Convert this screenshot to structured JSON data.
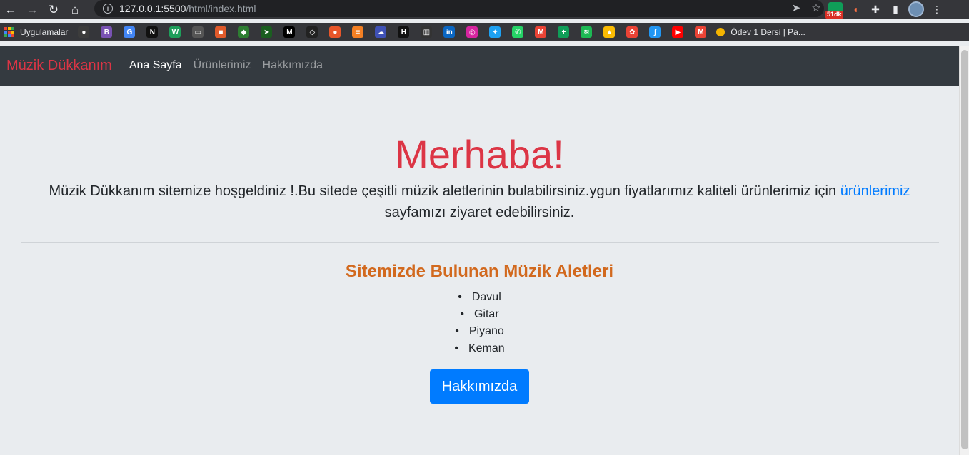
{
  "browser": {
    "url_host": "127.0.0.1:5500",
    "url_path": "/html/index.html",
    "extension_badge": "51dk",
    "bookmarks_apps_label": "Uygulamalar",
    "last_bookmark_label": "Ödev 1 Dersi | Pa...",
    "bookmark_icons": [
      {
        "name": "github-icon",
        "glyph": "●",
        "color": "#3c3c3c"
      },
      {
        "name": "bootstrap-icon",
        "glyph": "B",
        "color": "#7952b3"
      },
      {
        "name": "google-translate-icon",
        "glyph": "G",
        "color": "#4285f4"
      },
      {
        "name": "notion-icon",
        "glyph": "N",
        "color": "#111111"
      },
      {
        "name": "webflow-icon",
        "glyph": "W",
        "color": "#1e9e5a"
      },
      {
        "name": "video-icon",
        "glyph": "▭",
        "color": "#555555"
      },
      {
        "name": "office-icon",
        "glyph": "■",
        "color": "#e05a2b"
      },
      {
        "name": "shield-icon",
        "glyph": "◆",
        "color": "#2e7d32"
      },
      {
        "name": "arrow-icon",
        "glyph": "➤",
        "color": "#1b5e20"
      },
      {
        "name": "medium-icon",
        "glyph": "M",
        "color": "#000000"
      },
      {
        "name": "codepen-icon",
        "glyph": "◇",
        "color": "#222222"
      },
      {
        "name": "orange-icon",
        "glyph": "●",
        "color": "#e8562a"
      },
      {
        "name": "stackoverflow-icon",
        "glyph": "≡",
        "color": "#f48024"
      },
      {
        "name": "cloud-icon",
        "glyph": "☁",
        "color": "#3f51b5"
      },
      {
        "name": "hackernoon-icon",
        "glyph": "H",
        "color": "#111111"
      },
      {
        "name": "bank-icon",
        "glyph": "▥",
        "color": "#333333"
      },
      {
        "name": "linkedin-icon",
        "glyph": "in",
        "color": "#0a66c2"
      },
      {
        "name": "instagram-icon",
        "glyph": "◎",
        "color": "#d6249f"
      },
      {
        "name": "twitter-icon",
        "glyph": "✦",
        "color": "#1da1f2"
      },
      {
        "name": "whatsapp-icon",
        "glyph": "✆",
        "color": "#25d366"
      },
      {
        "name": "gmail-icon",
        "glyph": "M",
        "color": "#ea4335"
      },
      {
        "name": "sheets-plus-icon",
        "glyph": "+",
        "color": "#0f9d58"
      },
      {
        "name": "spotify-icon",
        "glyph": "≋",
        "color": "#1db954"
      },
      {
        "name": "drive-icon",
        "glyph": "▲",
        "color": "#fbbc04"
      },
      {
        "name": "photos-icon",
        "glyph": "✿",
        "color": "#ea4335"
      },
      {
        "name": "feather-icon",
        "glyph": "ʃ",
        "color": "#2196f3"
      },
      {
        "name": "youtube-icon",
        "glyph": "▶",
        "color": "#ff0000"
      },
      {
        "name": "gmail-icon-2",
        "glyph": "M",
        "color": "#ea4335"
      }
    ]
  },
  "navbar": {
    "brand": "Müzik Dükkanım",
    "links": [
      "Ana Sayfa",
      "Ürünlerimiz",
      "Hakkımızda"
    ],
    "active_index": 0,
    "bg_color": "#343a40",
    "brand_color": "#dc3545"
  },
  "hero": {
    "title": "Merhaba!",
    "lead_text": "Müzik Dükkanım sitemize hoşgeldiniz !.Bu sitede çeşitli müzik aletlerinin bulabilirsiniz.ygun fiyatlarımız kaliteli ürünlerimiz için",
    "lead_link": "ürünlerimiz",
    "lead_tail": "sayfamızı ziyaret edebilirsiniz."
  },
  "instruments": {
    "heading": "Sitemizde Bulunan Müzik Aletleri",
    "items": [
      "Davul",
      "Gitar",
      "Piyano",
      "Keman"
    ]
  },
  "cta": {
    "label": "Hakkımızda",
    "color": "#007bff"
  }
}
